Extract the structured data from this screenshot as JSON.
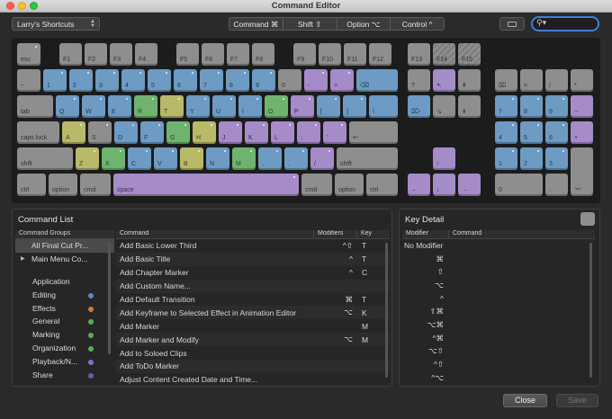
{
  "window": {
    "title": "Command Editor"
  },
  "toolbar": {
    "preset": "Larry's Shortcuts",
    "modifiers": [
      "Command ⌘",
      "Shift ⇧",
      "Option ⌥",
      "Control ^"
    ],
    "keyboard_view_icon": "keyboard-icon",
    "search_icon": "search-icon"
  },
  "keyboard": {
    "function_row": [
      "esc",
      "F1",
      "F2",
      "F3",
      "F4",
      "F5",
      "F6",
      "F7",
      "F8",
      "F9",
      "F10",
      "F11",
      "F12",
      "F13",
      "F14",
      "F15"
    ],
    "number_row": [
      "~",
      "1",
      "2",
      "3",
      "4",
      "5",
      "6",
      "7",
      "8",
      "9",
      "0",
      "-",
      "="
    ],
    "qwerty_row": [
      "tab",
      "Q",
      "W",
      "E",
      "R",
      "T",
      "Y",
      "U",
      "I",
      "O",
      "P",
      "[",
      "]",
      "\\"
    ],
    "home_row": [
      "caps lock",
      "A",
      "S",
      "D",
      "F",
      "G",
      "H",
      "J",
      "K",
      "L",
      ";",
      "'"
    ],
    "shift_row": [
      "shift",
      "Z",
      "X",
      "C",
      "V",
      "B",
      "N",
      "M",
      ",",
      ".",
      "/",
      "shift"
    ],
    "bottom_row": [
      "ctrl",
      "option",
      "cmd",
      "space",
      "cmd",
      "option",
      "ctrl"
    ],
    "colors": {
      "blue": "#6d9bc4",
      "purple": "#a58bc8",
      "green": "#6fb36f",
      "yellow": "#b9b96a",
      "grey": "#8e8e8e"
    }
  },
  "command_list": {
    "title": "Command List",
    "groups_header": "Command Groups",
    "groups": [
      {
        "label": "All Final Cut Pr...",
        "selected": true
      },
      {
        "label": "Main Menu Co...",
        "expandable": true
      }
    ],
    "subgroups": [
      {
        "label": "Application",
        "color": ""
      },
      {
        "label": "Editing",
        "color": "#5b86c8"
      },
      {
        "label": "Effects",
        "color": "#c8784a"
      },
      {
        "label": "General",
        "color": "#5bab5b"
      },
      {
        "label": "Marking",
        "color": "#5bab5b"
      },
      {
        "label": "Organization",
        "color": "#5bab5b"
      },
      {
        "label": "Playback/N...",
        "color": "#8a6fc0"
      },
      {
        "label": "Share",
        "color": "#5b5fb0"
      }
    ],
    "columns": [
      "Command",
      "Modifiers",
      "Key"
    ],
    "rows": [
      {
        "command": "Add Basic Lower Third",
        "modifiers": "^⇧",
        "key": "T"
      },
      {
        "command": "Add Basic Title",
        "modifiers": "^",
        "key": "T"
      },
      {
        "command": "Add Chapter Marker",
        "modifiers": "^",
        "key": "C"
      },
      {
        "command": "Add Custom Name...",
        "modifiers": "",
        "key": ""
      },
      {
        "command": "Add Default Transition",
        "modifiers": "⌘",
        "key": "T"
      },
      {
        "command": "Add Keyframe to Selected Effect in Animation Editor",
        "modifiers": "⌥",
        "key": "K"
      },
      {
        "command": "Add Marker",
        "modifiers": "",
        "key": "M"
      },
      {
        "command": "Add Marker and Modify",
        "modifiers": "⌥",
        "key": "M"
      },
      {
        "command": "Add to Soloed Clips",
        "modifiers": "",
        "key": ""
      },
      {
        "command": "Add ToDo Marker",
        "modifiers": "",
        "key": ""
      },
      {
        "command": "Adjust Content Created Date and Time...",
        "modifiers": "",
        "key": ""
      }
    ]
  },
  "key_detail": {
    "title": "Key Detail",
    "columns": [
      "Modifier",
      "Command"
    ],
    "rows": [
      "No Modifier",
      "⌘",
      "⇧",
      "⌥",
      "^",
      "⇧⌘",
      "⌥⌘",
      "^⌘",
      "⌥⇧",
      "^⇧",
      "^⌥"
    ]
  },
  "buttons": {
    "close": "Close",
    "save": "Save"
  }
}
